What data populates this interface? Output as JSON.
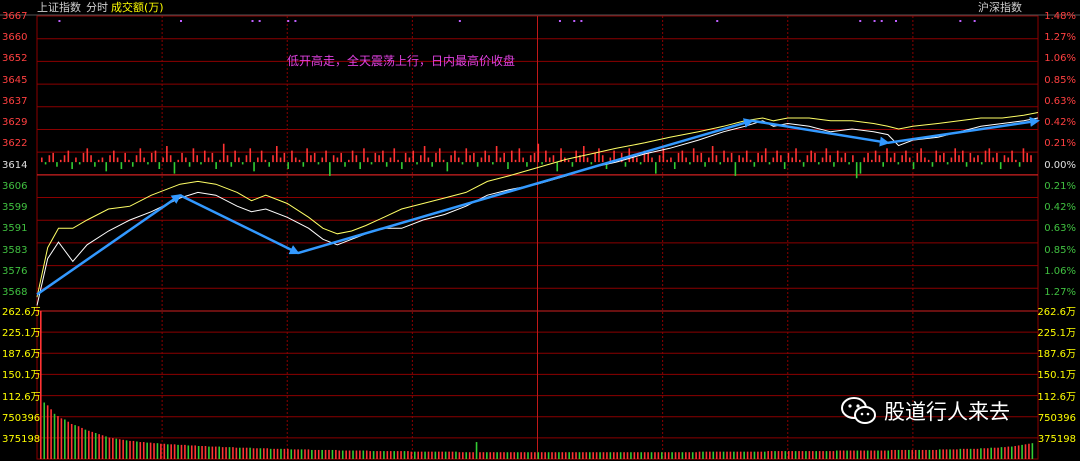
{
  "header": {
    "index_name": "上证指数",
    "tab_time": "分时",
    "tab_volume": "成交额(万)",
    "right_button": "沪深指数"
  },
  "annotation": "低开高走，全天震荡上行，日内最高价收盘",
  "watermark": "股道行人来去",
  "colors": {
    "background": "#000000",
    "grid": "#8b0000",
    "up": "#ff3333",
    "down": "#33cc33",
    "price_line": "#ffffff",
    "avg_line": "#ffff66",
    "trend_arrow": "#3399ff",
    "axis_text": "#ff4040",
    "vol_text": "#ffff00"
  },
  "chart_data": {
    "type": "line",
    "prev_close": 3614,
    "price_axis": {
      "left_ticks": [
        "3667",
        "3660",
        "3652",
        "3645",
        "3637",
        "3629",
        "3622",
        "3614",
        "3606",
        "3599",
        "3591",
        "3583",
        "3576",
        "3568"
      ],
      "right_ticks": [
        "1.48%",
        "1.27%",
        "1.06%",
        "0.85%",
        "0.63%",
        "0.42%",
        "0.21%",
        "0.00%",
        "0.21%",
        "0.42%",
        "0.63%",
        "0.85%",
        "1.06%",
        "1.27%"
      ],
      "ylim": [
        3560,
        3667
      ]
    },
    "volume_axis": {
      "left_ticks": [
        "262.6万",
        "225.1万",
        "187.6万",
        "150.1万",
        "112.6万",
        "750396",
        "375198"
      ],
      "right_ticks": [
        "262.6万",
        "225.1万",
        "187.6万",
        "150.1万",
        "112.6万",
        "750396",
        "375198"
      ],
      "ylim": [
        0,
        2626000
      ]
    },
    "series": [
      {
        "values": [
          [
            0,
            3562
          ],
          [
            3,
            3579
          ],
          [
            6,
            3585
          ],
          [
            10,
            3578
          ],
          [
            14,
            3584
          ],
          [
            20,
            3589
          ],
          [
            26,
            3593
          ],
          [
            32,
            3596
          ],
          [
            40,
            3601
          ],
          [
            45,
            3603
          ],
          [
            50,
            3602
          ],
          [
            56,
            3598
          ],
          [
            60,
            3596
          ],
          [
            64,
            3597
          ],
          [
            70,
            3594
          ],
          [
            76,
            3590
          ],
          [
            80,
            3586
          ],
          [
            84,
            3584
          ],
          [
            88,
            3586
          ],
          [
            92,
            3588
          ],
          [
            97,
            3590
          ],
          [
            102,
            3590
          ],
          [
            108,
            3593
          ],
          [
            114,
            3595
          ],
          [
            120,
            3598
          ],
          [
            126,
            3602
          ],
          [
            132,
            3604
          ],
          [
            140,
            3606
          ],
          [
            148,
            3609
          ],
          [
            155,
            3612
          ],
          [
            162,
            3614
          ],
          [
            170,
            3617
          ],
          [
            177,
            3619
          ],
          [
            185,
            3622
          ],
          [
            192,
            3625
          ],
          [
            198,
            3627
          ],
          [
            203,
            3629
          ],
          [
            206,
            3627
          ],
          [
            210,
            3628
          ],
          [
            216,
            3627
          ],
          [
            222,
            3625
          ],
          [
            228,
            3626
          ],
          [
            234,
            3625
          ],
          [
            238,
            3624
          ],
          [
            241,
            3620
          ],
          [
            245,
            3622
          ],
          [
            252,
            3623
          ],
          [
            258,
            3625
          ],
          [
            264,
            3627
          ],
          [
            270,
            3628
          ],
          [
            276,
            3629
          ],
          [
            280,
            3630
          ]
        ]
      },
      {
        "values": [
          [
            0,
            3565
          ],
          [
            3,
            3583
          ],
          [
            6,
            3590
          ],
          [
            10,
            3590
          ],
          [
            14,
            3593
          ],
          [
            20,
            3597
          ],
          [
            26,
            3598
          ],
          [
            32,
            3602
          ],
          [
            40,
            3606
          ],
          [
            45,
            3607
          ],
          [
            50,
            3606
          ],
          [
            56,
            3603
          ],
          [
            60,
            3600
          ],
          [
            64,
            3602
          ],
          [
            70,
            3599
          ],
          [
            76,
            3594
          ],
          [
            80,
            3590
          ],
          [
            84,
            3588
          ],
          [
            88,
            3589
          ],
          [
            92,
            3591
          ],
          [
            97,
            3594
          ],
          [
            102,
            3597
          ],
          [
            108,
            3599
          ],
          [
            114,
            3601
          ],
          [
            120,
            3603
          ],
          [
            126,
            3607
          ],
          [
            132,
            3609
          ],
          [
            140,
            3612
          ],
          [
            148,
            3615
          ],
          [
            155,
            3617
          ],
          [
            162,
            3619
          ],
          [
            170,
            3621
          ],
          [
            177,
            3623
          ],
          [
            185,
            3625
          ],
          [
            192,
            3627
          ],
          [
            198,
            3629
          ],
          [
            203,
            3630
          ],
          [
            206,
            3629
          ],
          [
            210,
            3630
          ],
          [
            216,
            3630
          ],
          [
            222,
            3629
          ],
          [
            228,
            3629
          ],
          [
            234,
            3628
          ],
          [
            238,
            3627
          ],
          [
            241,
            3626
          ],
          [
            245,
            3627
          ],
          [
            252,
            3628
          ],
          [
            258,
            3629
          ],
          [
            264,
            3630
          ],
          [
            270,
            3630
          ],
          [
            276,
            3631
          ],
          [
            280,
            3632
          ]
        ]
      }
    ],
    "trend_arrows": [
      [
        [
          0,
          3566
        ],
        [
          40,
          3602
        ]
      ],
      [
        [
          40,
          3602
        ],
        [
          73,
          3581
        ]
      ],
      [
        [
          73,
          3581
        ],
        [
          200,
          3629
        ]
      ],
      [
        [
          200,
          3629
        ],
        [
          238,
          3621
        ]
      ],
      [
        [
          238,
          3621
        ],
        [
          280,
          3629
        ]
      ]
    ],
    "volume_diff_bars": [
      2,
      -1,
      3,
      4,
      -2,
      1,
      3,
      5,
      -3,
      2,
      -1,
      4,
      6,
      3,
      -2,
      1,
      2,
      -4,
      3,
      5,
      2,
      -3,
      4,
      1,
      -2,
      3,
      6,
      2,
      -1,
      4,
      5,
      -3,
      2,
      7,
      3,
      -5,
      1,
      4,
      2,
      -2,
      6,
      3,
      -1,
      5,
      2,
      4,
      -3,
      1,
      8,
      3,
      -2,
      5,
      2,
      -1,
      3,
      6,
      -4,
      2,
      5,
      1,
      -2,
      3,
      7,
      2,
      4,
      -3,
      5,
      2,
      1,
      -2,
      6,
      3,
      4,
      -1,
      2,
      5,
      -6,
      3,
      2,
      4,
      -2,
      1,
      5,
      3,
      -3,
      6,
      2,
      -1,
      4,
      3,
      5,
      -2,
      2,
      6,
      1,
      -3,
      4,
      2,
      5,
      -1,
      3,
      7,
      2,
      -2,
      4,
      6,
      1,
      -4,
      3,
      5,
      2,
      -1,
      6,
      3,
      4,
      -2,
      2,
      5,
      3,
      -1,
      7,
      2,
      4,
      -3,
      5,
      1,
      6,
      2,
      -2,
      3,
      4,
      8,
      -1,
      5,
      2,
      3,
      -4,
      6,
      2,
      1,
      -2,
      5,
      3,
      7,
      2,
      -1,
      4,
      6,
      3,
      -3,
      2,
      5,
      1,
      4,
      -2,
      6,
      3,
      2,
      -1,
      5,
      4,
      2,
      -5,
      3,
      6,
      1,
      2,
      -3,
      4,
      5,
      2,
      -1,
      6,
      3,
      4,
      -2,
      2,
      7,
      3,
      -1,
      5,
      2,
      4,
      -6,
      3,
      2,
      5,
      1,
      -2,
      4,
      3,
      6,
      -1,
      2,
      5,
      3,
      -3,
      4,
      2,
      6,
      1,
      -2,
      3,
      5,
      4,
      -1,
      2,
      6,
      3,
      -2,
      5,
      2,
      4,
      -1,
      3,
      -7,
      -5,
      2,
      4,
      1,
      5,
      3,
      -2,
      6,
      2,
      4,
      -1,
      3,
      5,
      2,
      -3,
      4,
      6,
      2,
      1,
      -2,
      5,
      3,
      4,
      -1,
      2,
      6,
      3,
      5,
      -2,
      4,
      2,
      3,
      -1,
      5,
      6,
      2,
      4,
      -3,
      3,
      2,
      5,
      1,
      -2,
      6,
      4,
      3
    ],
    "volume_bars": [
      262,
      100,
      95,
      88,
      80,
      76,
      72,
      70,
      66,
      62,
      60,
      58,
      55,
      52,
      50,
      48,
      46,
      44,
      42,
      40,
      38,
      37,
      36,
      35,
      34,
      33,
      32,
      32,
      31,
      30,
      30,
      29,
      29,
      28,
      28,
      27,
      27,
      26,
      26,
      26,
      25,
      25,
      25,
      24,
      24,
      24,
      23,
      23,
      23,
      22,
      22,
      22,
      22,
      21,
      21,
      21,
      21,
      20,
      20,
      20,
      20,
      20,
      19,
      19,
      19,
      19,
      19,
      18,
      18,
      18,
      18,
      18,
      18,
      17,
      17,
      17,
      17,
      17,
      17,
      16,
      16,
      16,
      16,
      16,
      16,
      16,
      16,
      15,
      15,
      15,
      15,
      15,
      15,
      15,
      15,
      15,
      14,
      14,
      14,
      14,
      14,
      14,
      14,
      14,
      14,
      14,
      14,
      14,
      13,
      13,
      13,
      13,
      13,
      13,
      13,
      13,
      13,
      13,
      13,
      13,
      13,
      13,
      12,
      12,
      12,
      12,
      12,
      30,
      12,
      12,
      12,
      12,
      12,
      12,
      12,
      12,
      12,
      12,
      12,
      12,
      12,
      12,
      12,
      12,
      12,
      12,
      12,
      12,
      12,
      12,
      12,
      12,
      12,
      12,
      12,
      12,
      12,
      12,
      12,
      12,
      12,
      12,
      12,
      12,
      12,
      12,
      12,
      12,
      12,
      12,
      12,
      12,
      12,
      12,
      12,
      12,
      12,
      12,
      12,
      12,
      12,
      12,
      12,
      12,
      12,
      12,
      12,
      12,
      12,
      12,
      12,
      12,
      13,
      13,
      13,
      13,
      13,
      13,
      13,
      13,
      13,
      13,
      13,
      13,
      13,
      13,
      13,
      13,
      13,
      13,
      13,
      13,
      14,
      14,
      14,
      14,
      14,
      14,
      14,
      14,
      14,
      14,
      14,
      14,
      14,
      14,
      14,
      14,
      14,
      14,
      14,
      14,
      15,
      15,
      15,
      15,
      15,
      15,
      15,
      15,
      15,
      15,
      15,
      15,
      15,
      15,
      15,
      15,
      16,
      16,
      16,
      16,
      16,
      16,
      16,
      16,
      16,
      16,
      16,
      16,
      16,
      16,
      17,
      17,
      17,
      17,
      17,
      17,
      18,
      18,
      18,
      18,
      18,
      18,
      19,
      19,
      19,
      20,
      20,
      20,
      21,
      21,
      22,
      22,
      23,
      24,
      25,
      26,
      27,
      28
    ]
  }
}
